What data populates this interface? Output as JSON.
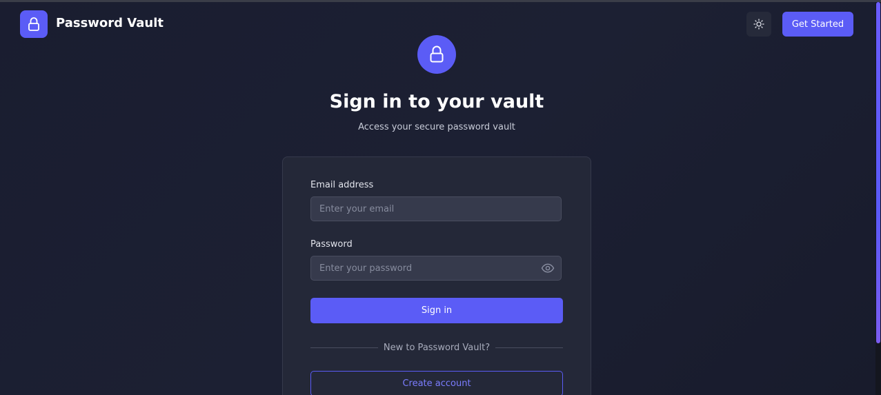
{
  "header": {
    "brand": "Password Vault",
    "logo_icon": "lock-icon",
    "theme_icon": "sun-icon",
    "get_started_label": "Get Started"
  },
  "hero": {
    "icon": "lock-icon",
    "title": "Sign in to your vault",
    "subtitle": "Access your secure password vault"
  },
  "form": {
    "email_label": "Email address",
    "email_placeholder": "Enter your email",
    "email_value": "",
    "password_label": "Password",
    "password_placeholder": "Enter your password",
    "password_value": "",
    "toggle_icon": "eye-icon",
    "signin_label": "Sign in",
    "divider_text": "New to Password Vault?",
    "create_label": "Create account"
  },
  "colors": {
    "accent": "#5b5cf6",
    "background": "#1c2033",
    "card": "#242838"
  }
}
